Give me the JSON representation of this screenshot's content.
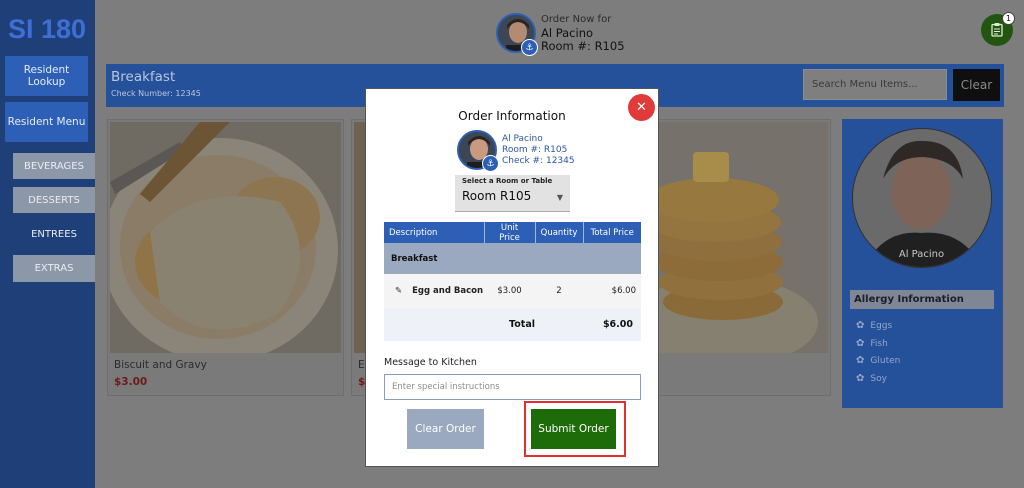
{
  "app": {
    "logo": "SI 180"
  },
  "sidebar": {
    "resident_lookup": "Resident Lookup",
    "resident_menu": "Resident Menu",
    "categories": [
      "BEVERAGES",
      "DESSERTS",
      "ENTREES",
      "EXTRAS"
    ],
    "active_category": "ENTREES"
  },
  "header": {
    "order_now_for": "Order Now for",
    "resident_name": "Al Pacino",
    "room": "Room #: R105",
    "order_count": "1"
  },
  "menubar": {
    "title": "Breakfast",
    "check_number": "Check Number: 12345",
    "search_placeholder": "Search Menu Items...",
    "clear_label": "Clear"
  },
  "cards": [
    {
      "name": "Biscuit and Gravy",
      "price": "$3.00"
    },
    {
      "name": "Eg",
      "price": "$"
    },
    {
      "name": "",
      "price": ""
    }
  ],
  "allergy": {
    "name": "Al Pacino",
    "heading": "Allergy Information",
    "items": [
      "Eggs",
      "Fish",
      "Gluten",
      "Soy"
    ]
  },
  "modal": {
    "title": "Order Information",
    "close_icon": "close-icon",
    "resident_name": "Al Pacino",
    "room": "Room #: R105",
    "check": "Check #: 12345",
    "room_select_label": "Select a Room or Table",
    "room_select_value": "Room R105",
    "columns": [
      "Description",
      "Unit Price",
      "Quantity",
      "Total Price"
    ],
    "section": "Breakfast",
    "items": [
      {
        "description": "Egg and Bacon",
        "unit_price": "$3.00",
        "quantity": "2",
        "total_price": "$6.00"
      }
    ],
    "total_label": "Total",
    "total_value": "$6.00",
    "message_label": "Message to Kitchen",
    "message_placeholder": "Enter special instructions",
    "clear_order": "Clear Order",
    "submit_order": "Submit Order"
  },
  "colors": {
    "sidebar": "#1f3f78",
    "accent": "#2c5fb5",
    "submit": "#1d6b09",
    "close": "#e03a3a",
    "highlight": "#e03030"
  }
}
